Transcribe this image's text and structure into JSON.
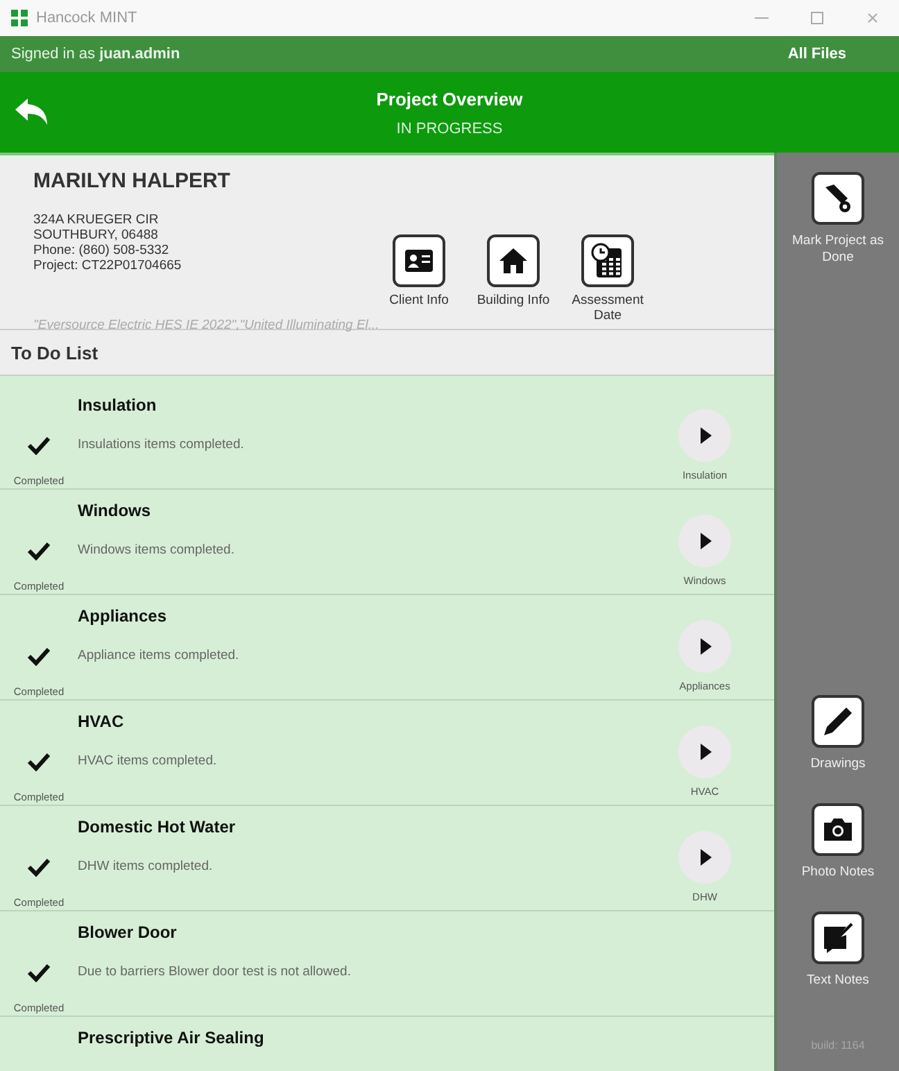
{
  "window": {
    "title": "Hancock MINT"
  },
  "top_bar": {
    "signed_in_label": "Signed in as",
    "user": "juan.admin",
    "all_files": "All Files"
  },
  "header": {
    "title": "Project Overview",
    "status": "IN PROGRESS"
  },
  "client": {
    "name": "MARILYN HALPERT",
    "address_lines": [
      "324A KRUEGER CIR",
      "SOUTHBURY, 06488",
      "Phone: (860) 508-5332",
      "Project: CT22P01704665"
    ],
    "programs": "\"Eversource Electric HES IE 2022\",\"United Illuminating El...",
    "actions": [
      {
        "kind": "client",
        "label": "Client Info"
      },
      {
        "kind": "building",
        "label": "Building Info"
      },
      {
        "kind": "calendar",
        "label": "Assessment Date"
      }
    ]
  },
  "todo": {
    "title": "To Do List",
    "items": [
      {
        "title": "Insulation",
        "description": "Insulations items completed.",
        "completed": true,
        "status": "Completed",
        "button_label": "Insulation"
      },
      {
        "title": "Windows",
        "description": "Windows items completed.",
        "completed": true,
        "status": "Completed",
        "button_label": "Windows"
      },
      {
        "title": "Appliances",
        "description": "Appliance items completed.",
        "completed": true,
        "status": "Completed",
        "button_label": "Appliances"
      },
      {
        "title": "HVAC",
        "description": "HVAC items completed.",
        "completed": true,
        "status": "Completed",
        "button_label": "HVAC"
      },
      {
        "title": "Domestic Hot Water",
        "description": "DHW items completed.",
        "completed": true,
        "status": "Completed",
        "button_label": "DHW"
      },
      {
        "title": "Blower Door",
        "description": "Due to barriers Blower door test is not allowed.",
        "completed": true,
        "status": "Completed"
      },
      {
        "title": "Prescriptive Air Sealing"
      }
    ]
  },
  "sidebar": {
    "actions": [
      {
        "kind": "done",
        "label": "Mark Project as Done"
      },
      {
        "kind": "pencil",
        "label": "Drawings"
      },
      {
        "kind": "camera",
        "label": "Photo Notes"
      },
      {
        "kind": "note",
        "label": "Text Notes"
      }
    ],
    "build": "build: 1164"
  }
}
